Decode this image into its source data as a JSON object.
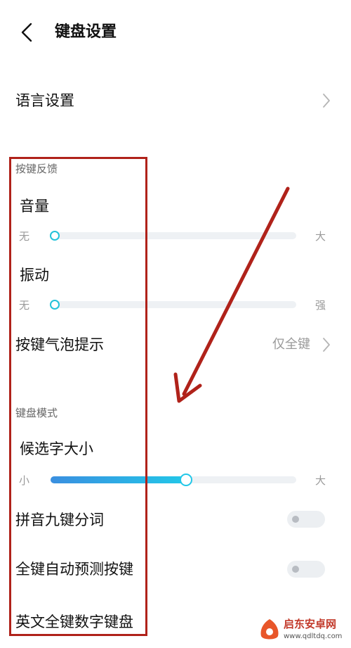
{
  "header": {
    "title": "键盘设置",
    "back_icon": "chevron-left-icon"
  },
  "language": {
    "label": "语言设置"
  },
  "feedback_section": {
    "title": "按键反馈",
    "volume": {
      "label": "音量",
      "min_label": "无",
      "max_label": "大",
      "level": 0.0
    },
    "vibration": {
      "label": "振动",
      "min_label": "无",
      "max_label": "强",
      "level": 0.0
    },
    "bubble": {
      "label": "按键气泡提示",
      "value": "仅全键"
    }
  },
  "keyboard_section": {
    "title": "键盘模式",
    "candidate_size": {
      "label": "候选字大小",
      "min_label": "小",
      "max_label": "大",
      "level": 0.55
    },
    "pinyin_nine": {
      "label": "拼音九键分词",
      "enabled": false
    },
    "full_predict": {
      "label": "全键自动预测按键",
      "enabled": false
    },
    "english_numeric": {
      "label": "英文全键数字键盘"
    }
  },
  "colors": {
    "annotation_red": "#b0221a",
    "accent_cyan": "#23c2d9",
    "accent_blue": "#3a8fe0",
    "track_gray": "#eef1f4"
  },
  "watermark": {
    "brand": "启东安卓网",
    "url": "www.qdltdq.com"
  }
}
